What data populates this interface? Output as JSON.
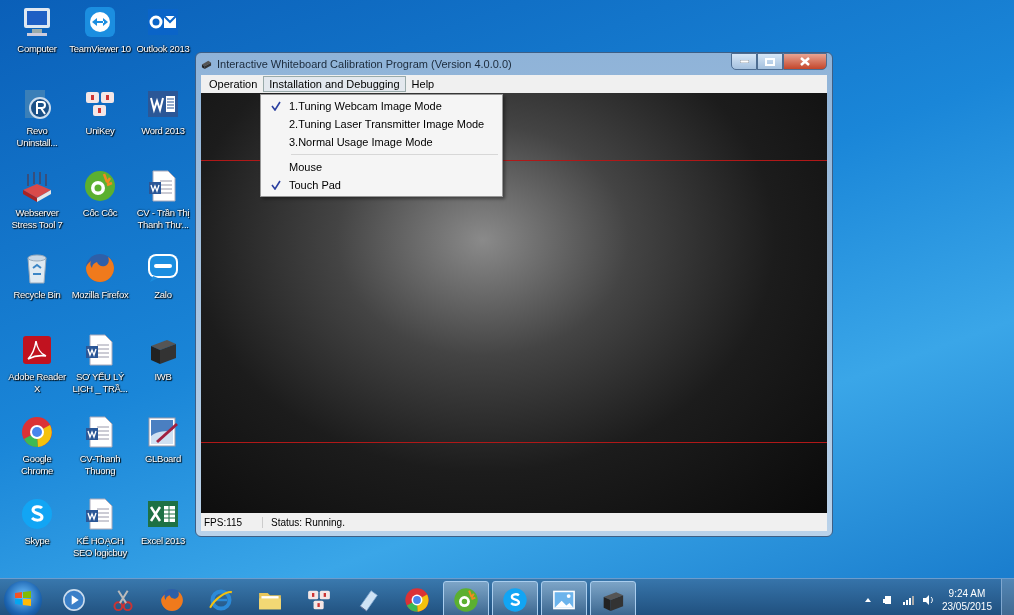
{
  "desktop": {
    "icons": [
      {
        "label": "Computer",
        "kind": "computer"
      },
      {
        "label": "TeamViewer 10",
        "kind": "teamviewer"
      },
      {
        "label": "Outlook 2013",
        "kind": "outlook"
      },
      {
        "label": "Revo Uninstall...",
        "kind": "revo"
      },
      {
        "label": "UniKey",
        "kind": "unikey"
      },
      {
        "label": "Word 2013",
        "kind": "word"
      },
      {
        "label": "Webserver Stress Tool 7",
        "kind": "router"
      },
      {
        "label": "Cốc Cốc",
        "kind": "coccoc"
      },
      {
        "label": "CV - Trần Thị Thanh Thư...",
        "kind": "doc"
      },
      {
        "label": "Recycle Bin",
        "kind": "recycle"
      },
      {
        "label": "Mozilla Firefox",
        "kind": "firefox"
      },
      {
        "label": "Zalo",
        "kind": "chat"
      },
      {
        "label": "Adobe Reader X",
        "kind": "acrobat"
      },
      {
        "label": "SƠ YẾU LÝ LỊCH _ TRẦ...",
        "kind": "doc"
      },
      {
        "label": "IWB",
        "kind": "box"
      },
      {
        "label": "Google Chrome",
        "kind": "chrome"
      },
      {
        "label": "CV-Thanh Thuong",
        "kind": "doc"
      },
      {
        "label": "GLBoard",
        "kind": "paint"
      },
      {
        "label": "Skype",
        "kind": "skype"
      },
      {
        "label": "KẾ HOẠCH SEO logicbuy",
        "kind": "doc"
      },
      {
        "label": "Excel 2013",
        "kind": "excel"
      }
    ]
  },
  "window": {
    "title": "Interactive Whiteboard Calibration Program (Version 4.0.0.0)",
    "menu": [
      {
        "label": "Operation",
        "selected": false
      },
      {
        "label": "Installation and Debugging",
        "selected": true
      },
      {
        "label": "Help",
        "selected": false
      }
    ],
    "dropdown": [
      {
        "kind": "item",
        "label": "1.Tuning Webcam Image Mode",
        "checked": true
      },
      {
        "kind": "item",
        "label": "2.Tuning Laser Transmitter Image Mode",
        "checked": false
      },
      {
        "kind": "item",
        "label": "3.Normal Usage Image Mode",
        "checked": false
      },
      {
        "kind": "separator"
      },
      {
        "kind": "item",
        "label": "Mouse",
        "checked": false
      },
      {
        "kind": "item",
        "label": "Touch Pad",
        "checked": true
      }
    ],
    "status_bar": {
      "fps": "FPS:115",
      "status": "Status: Running."
    }
  },
  "taskbar": {
    "items": [
      {
        "kind": "media",
        "active": false
      },
      {
        "kind": "snip",
        "active": false
      },
      {
        "kind": "firefox",
        "active": false
      },
      {
        "kind": "ie",
        "active": false
      },
      {
        "kind": "folder",
        "active": false
      },
      {
        "kind": "unikey",
        "active": false
      },
      {
        "kind": "note",
        "active": false
      },
      {
        "kind": "chrome",
        "active": false
      },
      {
        "kind": "coccoc",
        "active": true
      },
      {
        "kind": "skype",
        "active": true
      },
      {
        "kind": "picture",
        "active": true
      },
      {
        "kind": "box",
        "active": true
      }
    ],
    "clock": {
      "time": "9:24 AM",
      "date": "23/05/2015"
    }
  }
}
